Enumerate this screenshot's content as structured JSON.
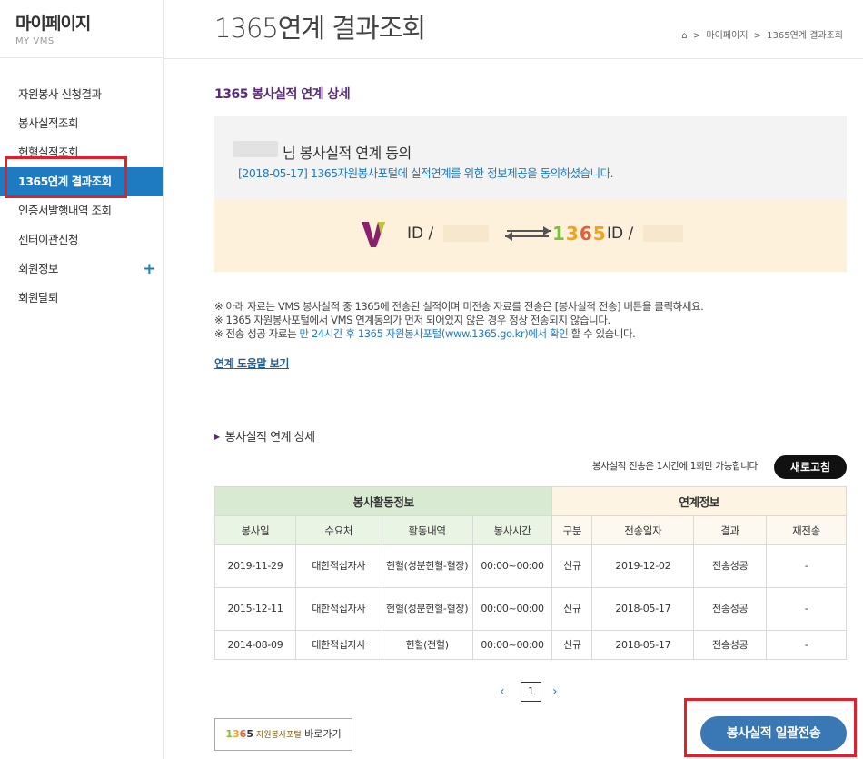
{
  "sidebar": {
    "title": "마이페이지",
    "subtitle": "MY VMS",
    "items": [
      {
        "label": "자원봉사 신청결과"
      },
      {
        "label": "봉사실적조회"
      },
      {
        "label": "헌혈실적조회"
      },
      {
        "label": "1365연계 결과조회",
        "active": true
      },
      {
        "label": "인증서발행내역 조회"
      },
      {
        "label": "센터이관신청"
      },
      {
        "label": "회원정보",
        "expand": "+"
      },
      {
        "label": "회원탈퇴"
      }
    ]
  },
  "header": {
    "title": "1365연계 결과조회",
    "breadcrumb": [
      "마이페이지",
      "1365연계 결과조회"
    ]
  },
  "section": {
    "title": "1365 봉사실적 연계 상세"
  },
  "consent": {
    "heading": "님 봉사실적 연계 동의",
    "message": "[2018-05-17] 1365자원봉사포털에 실적연계를 위한 정보제공을 동의하셨습니다."
  },
  "link_box": {
    "vms_id_label": "ID /",
    "portal_logo": "1365",
    "portal_id_label": "ID /"
  },
  "notes": {
    "line1": "※ 아래 자료는 VMS 봉사실적 중 1365에 전송된 실적이며 미전송 자료를 전송은 [봉사실적 전송] 버튼을 클릭하세요.",
    "line2": "※ 1365 자원봉사포털에서 VMS 연계동의가 먼저 되어있지 않은 경우 정상 전송되지 않습니다.",
    "line3_pre": "※ 전송 성공 자료는 ",
    "line3_hl": "만 24시간 후 1365 자원봉사포털(www.1365.go.kr)에서 확인",
    "line3_post": " 할 수 있습니다."
  },
  "help_link": "연계 도움말 보기",
  "detail": {
    "title": "봉사실적 연계 상세",
    "info_note": "봉사실적 전송은 1시간에 1회만 가능합니다",
    "refresh_label": "새로고침"
  },
  "table": {
    "group1": "봉사활동정보",
    "group2": "연계정보",
    "columns": [
      "봉사일",
      "수요처",
      "활동내역",
      "봉사시간",
      "구분",
      "전송일자",
      "결과",
      "재전송"
    ],
    "rows": [
      [
        "2019-11-29",
        "대한적십자사",
        "헌혈(성분헌혈-혈장)",
        "00:00~00:00",
        "신규",
        "2019-12-02",
        "전송성공",
        "-"
      ],
      [
        "2015-12-11",
        "대한적십자사",
        "헌혈(성분헌혈-혈장)",
        "00:00~00:00",
        "신규",
        "2018-05-17",
        "전송성공",
        "-"
      ],
      [
        "2014-08-09",
        "대한적십자사",
        "헌혈(전혈)",
        "00:00~00:00",
        "신규",
        "2018-05-17",
        "전송성공",
        "-"
      ]
    ]
  },
  "pagination": {
    "prev": "‹",
    "page": "1",
    "next": "›"
  },
  "buttons": {
    "portal_logo": "1365",
    "portal_text": "자원봉사포털",
    "portal_suffix": "바로가기",
    "send_all": "봉사실적 일괄전송"
  },
  "colors": {
    "accent": "#1f7bc1",
    "highlight_box": "#e0202a",
    "section_title": "#5a2a77",
    "send_button": "#3a77b5"
  }
}
